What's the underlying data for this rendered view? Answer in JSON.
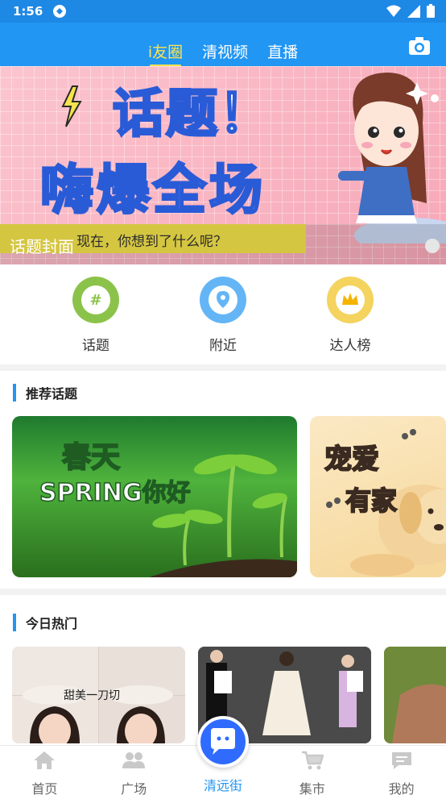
{
  "status_bar": {
    "time": "1:56"
  },
  "header": {
    "tabs": [
      "i友圈",
      "清视频",
      "直播"
    ],
    "active_tab": 0
  },
  "banner": {
    "title_line1": "话题！",
    "title_line2": "嗨爆全场",
    "subtitle": "现在，你想到了什么呢？",
    "caption": "话题封面"
  },
  "quick_actions": [
    {
      "label": "话题",
      "icon": "hash-icon",
      "color": "#8bc34a"
    },
    {
      "label": "附近",
      "icon": "location-icon",
      "color": "#64b5f6"
    },
    {
      "label": "达人榜",
      "icon": "crown-icon",
      "color": "#f4d35e"
    }
  ],
  "recommended": {
    "title": "推荐话题",
    "cards": [
      {
        "line1": "春天",
        "line2": "SPRING你好"
      },
      {
        "line1": "宠爱",
        "line2": "有家"
      }
    ]
  },
  "hot_today": {
    "title": "今日热门",
    "cards": [
      {
        "caption": "甜美一刀切"
      }
    ]
  },
  "bottom_nav": {
    "items": [
      "首页",
      "广场",
      "清远街",
      "集市",
      "我的"
    ],
    "active": 2
  },
  "colors": {
    "primary": "#2196f3",
    "tab_active": "#ffe34d",
    "center_button": "#2f6bff"
  }
}
